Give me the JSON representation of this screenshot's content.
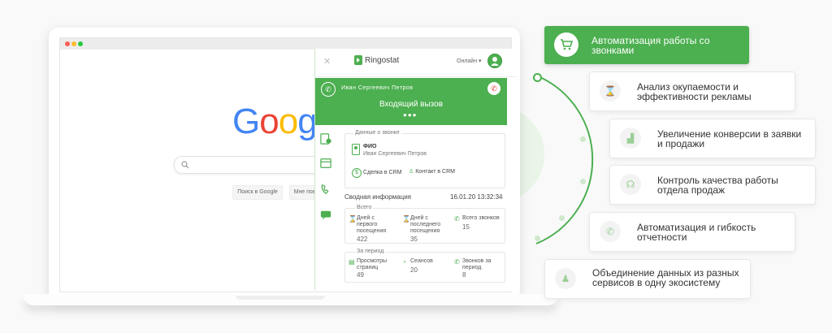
{
  "colors": {
    "accent": "#4caf50",
    "google_blue": "#4285f4",
    "google_red": "#ea4335",
    "google_yellow": "#fbbc05",
    "google_green": "#34a853"
  },
  "google": {
    "logo_letters": [
      "G",
      "o",
      "o",
      "g"
    ],
    "search_btn": "Поиск в Google",
    "lucky_btn": "Мне пове"
  },
  "extension": {
    "brand": "Ringostat",
    "status": "Онлайн",
    "caller_name": "Иван Сергеевич Петров",
    "call_state": "Входящий вызов",
    "call_data_title": "Данные о звонке",
    "fio_label": "ФИО",
    "fio_value": "Иван Сергеевич Петров",
    "crm_deal": "Сделка в CRM",
    "crm_contact": "Контакт в CRM",
    "summary_title": "Сводная информация",
    "summary_datetime": "16.01.20 13:32:34",
    "total": {
      "title": "Всего",
      "items": [
        {
          "label": "Дней с первого посещения",
          "value": "422"
        },
        {
          "label": "Дней с последнего посещения",
          "value": "35"
        },
        {
          "label": "Всего звонков",
          "value": "15"
        }
      ]
    },
    "period": {
      "title": "За период",
      "items": [
        {
          "label": "Просмотры страниц",
          "value": "49"
        },
        {
          "label": "Сеансов",
          "value": "20"
        },
        {
          "label": "Звонков за период",
          "value": "8"
        }
      ]
    }
  },
  "features": {
    "featured": "Автоматизация работы со звонками",
    "cards": [
      {
        "text": "Анализ окупаемости и эффективности рекламы",
        "icon": "hourglass-icon"
      },
      {
        "text": "Увеличение конверсии в заявки и продажи",
        "icon": "chart-icon"
      },
      {
        "text": "Контроль качества работы отдела продаж",
        "icon": "headset-icon"
      },
      {
        "text": "Автоматизация и гибкость отчетности",
        "icon": "phone-icon"
      },
      {
        "text": "Объединение данных из разных сервисов в одну экосистему",
        "icon": "user-icon"
      }
    ]
  }
}
